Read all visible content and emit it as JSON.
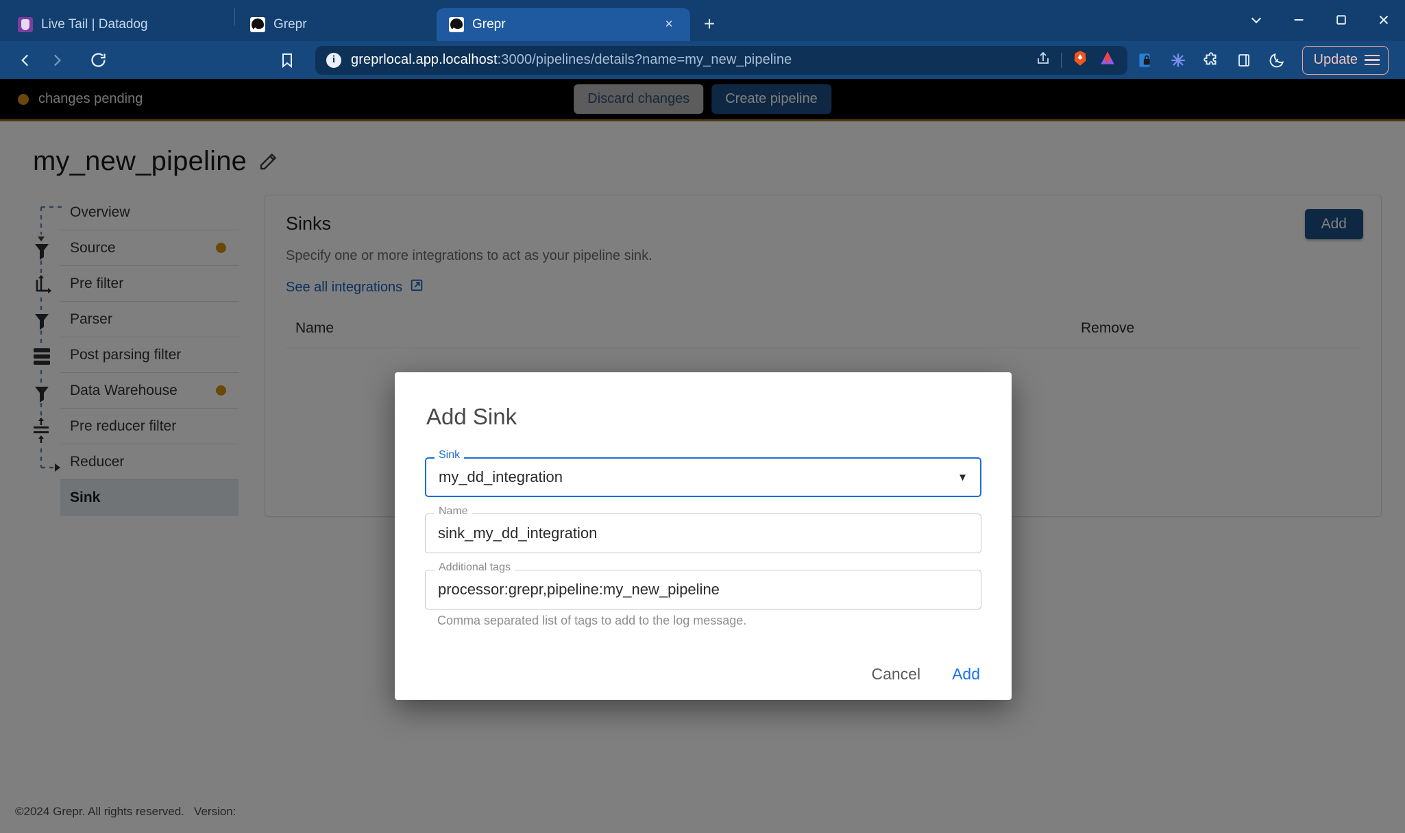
{
  "browser": {
    "tabs": [
      {
        "title": "Live Tail | Datadog",
        "favicon": "datadog-icon",
        "active": false
      },
      {
        "title": "Grepr",
        "favicon": "grepr-icon",
        "active": false
      },
      {
        "title": "Grepr",
        "favicon": "grepr-icon",
        "active": true
      }
    ],
    "new_tab_label": "+",
    "close_label": "×",
    "window_controls": [
      "chevron-down",
      "minimize",
      "maximize",
      "close"
    ],
    "nav": {
      "back": "back-icon",
      "forward": "forward-icon",
      "reload": "reload-icon",
      "bookmark": "bookmark-icon"
    },
    "omnibox": {
      "host": "greprlocal.app.localhost",
      "path": ":3000/pipelines/details?name=my_new_pipeline",
      "info_glyph": "i"
    },
    "toolbar_right": [
      "share-icon",
      "brave-lion-icon",
      "leo-ai-icon",
      "password-manager-icon",
      "extension-asterisk-icon",
      "extensions-puzzle-icon",
      "sidebar-toggle-icon",
      "night-mode-icon"
    ],
    "update_label": "Update"
  },
  "banner": {
    "status_text": "changes pending",
    "status_color": "#d48c18",
    "discard_label": "Discard changes",
    "create_label": "Create pipeline"
  },
  "page": {
    "pipeline_name": "my_new_pipeline",
    "edit_icon": "pencil-icon"
  },
  "sidebar": {
    "items": [
      {
        "label": "Overview",
        "dot": false,
        "selected": false,
        "rail": "none"
      },
      {
        "label": "Source",
        "dot": true,
        "selected": false,
        "rail": "source-branch"
      },
      {
        "label": "Pre filter",
        "dot": false,
        "selected": false,
        "rail": "filter-funnel-icon"
      },
      {
        "label": "Parser",
        "dot": false,
        "selected": false,
        "rail": "parser-crop-icon"
      },
      {
        "label": "Post parsing filter",
        "dot": false,
        "selected": false,
        "rail": "filter-funnel-icon"
      },
      {
        "label": "Data Warehouse",
        "dot": true,
        "selected": false,
        "rail": "database-icon"
      },
      {
        "label": "Pre reducer filter",
        "dot": false,
        "selected": false,
        "rail": "filter-funnel-icon"
      },
      {
        "label": "Reducer",
        "dot": false,
        "selected": false,
        "rail": "reducer-icon"
      },
      {
        "label": "Sink",
        "dot": false,
        "selected": true,
        "rail": "arrow-right-icon"
      }
    ]
  },
  "panel": {
    "title": "Sinks",
    "description": "Specify one or more integrations to act as your pipeline sink.",
    "link_label": "See all integrations",
    "link_icon": "external-link-icon",
    "add_label": "Add",
    "columns": [
      "Name",
      "Remove"
    ],
    "rows": []
  },
  "modal": {
    "title": "Add Sink",
    "sink_field": {
      "label": "Sink",
      "value": "my_dd_integration",
      "caret": "▼",
      "focused": true
    },
    "name_field": {
      "label": "Name",
      "value": "sink_my_dd_integration"
    },
    "tags_field": {
      "label": "Additional tags",
      "value": "processor:grepr,pipeline:my_new_pipeline"
    },
    "hint": "Comma separated list of tags to add to the log message.",
    "cancel_label": "Cancel",
    "add_label": "Add"
  },
  "footer": {
    "copyright": "©2024 Grepr. All rights reserved.",
    "version_label": "Version:"
  },
  "colors": {
    "browser_chrome": "#123f70",
    "accent_blue": "#1c4f86",
    "link_blue": "#1463b8",
    "focus_blue": "#1a6fd4",
    "status_amber": "#d48c18",
    "banner_bg": "#000000"
  }
}
